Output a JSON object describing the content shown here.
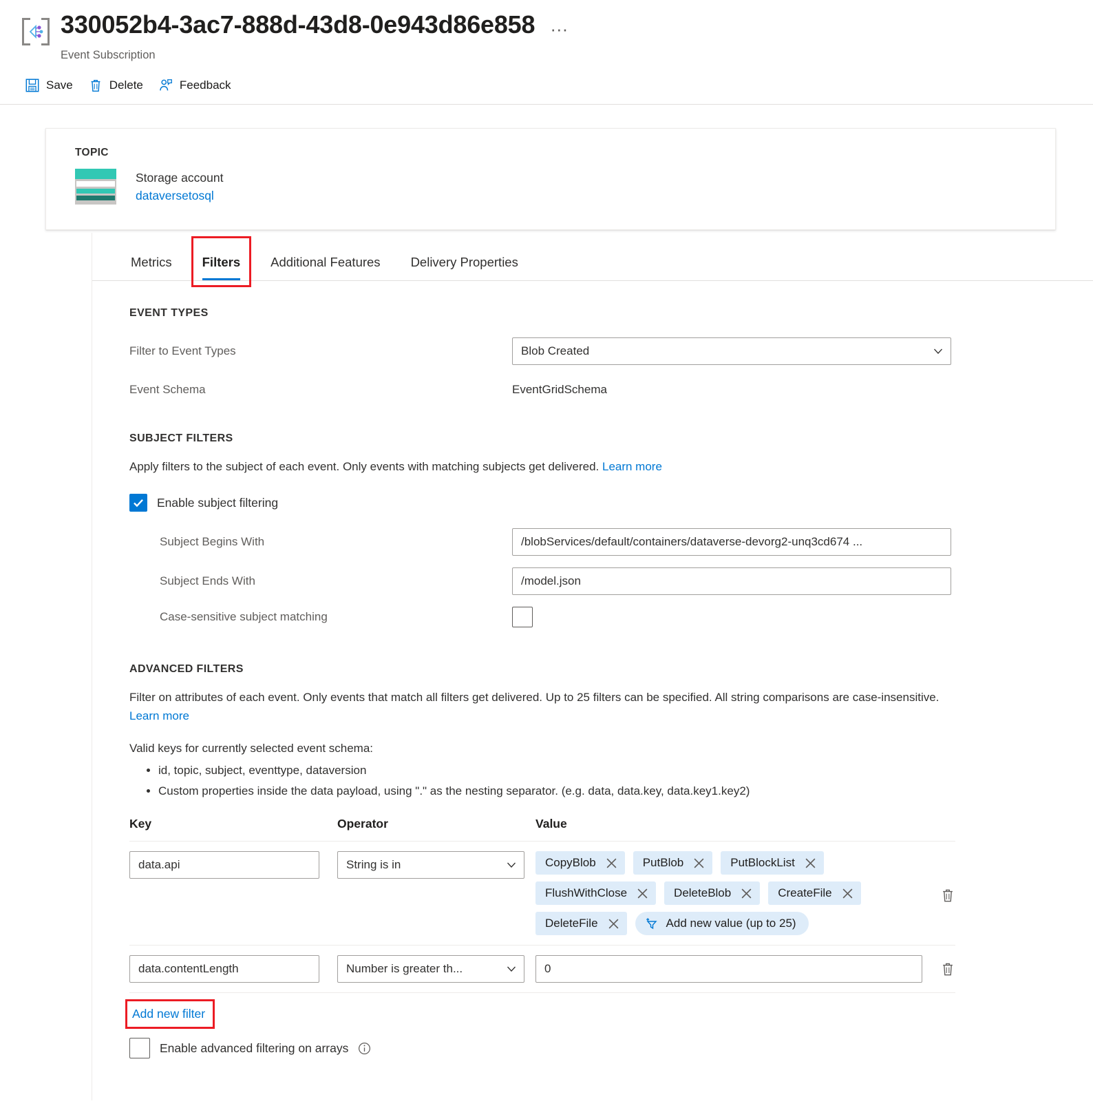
{
  "header": {
    "title": "330052b4-3ac7-888d-43d8-0e943d86e858",
    "subtitle": "Event Subscription",
    "more_label": "···",
    "icon": "event-subscription-icon"
  },
  "commandbar": {
    "items": [
      {
        "label": "Save",
        "icon": "save-icon"
      },
      {
        "label": "Delete",
        "icon": "trash-icon"
      },
      {
        "label": "Feedback",
        "icon": "feedback-person-icon"
      }
    ]
  },
  "topic": {
    "label": "TOPIC",
    "icon": "storage-account-icon",
    "kind": "Storage account",
    "name": "dataversetosql"
  },
  "tabs": [
    {
      "label": "Metrics",
      "active": false,
      "highlighted": false
    },
    {
      "label": "Filters",
      "active": true,
      "highlighted": true
    },
    {
      "label": "Additional Features",
      "active": false,
      "highlighted": false
    },
    {
      "label": "Delivery Properties",
      "active": false,
      "highlighted": false
    }
  ],
  "event_types": {
    "section_title": "EVENT TYPES",
    "filter_label": "Filter to Event Types",
    "filter_value": "Blob Created",
    "schema_label": "Event Schema",
    "schema_value": "EventGridSchema"
  },
  "subject_filters": {
    "section_title": "SUBJECT FILTERS",
    "description": "Apply filters to the subject of each event. Only events with matching subjects get delivered.",
    "learn_more": "Learn more",
    "enable_label": "Enable subject filtering",
    "enable_checked": true,
    "begins_with_label": "Subject Begins With",
    "begins_with_value": "/blobServices/default/containers/dataverse-devorg2-unq3cd674 ...",
    "ends_with_label": "Subject Ends With",
    "ends_with_value": "/model.json",
    "case_sensitive_label": "Case-sensitive subject matching",
    "case_sensitive_checked": false
  },
  "advanced_filters": {
    "section_title": "ADVANCED FILTERS",
    "description": "Filter on attributes of each event. Only events that match all filters get delivered. Up to 25 filters can be specified. All string comparisons are case-insensitive.",
    "learn_more": "Learn more",
    "valid_keys_intro": "Valid keys for currently selected event schema:",
    "valid_keys": [
      "id, topic, subject, eventtype, dataversion",
      "Custom properties inside the data payload, using \".\" as the nesting separator. (e.g. data, data.key, data.key1.key2)"
    ],
    "columns": {
      "key": "Key",
      "operator": "Operator",
      "value": "Value"
    },
    "rows": [
      {
        "key": "data.api",
        "operator": "String is in",
        "value_type": "chips",
        "chips": [
          "CopyBlob",
          "PutBlob",
          "PutBlockList",
          "FlushWithClose",
          "DeleteBlob",
          "CreateFile",
          "DeleteFile"
        ],
        "add_value_label": "Add new value (up to 25)",
        "delete_icon": "trash-icon"
      },
      {
        "key": "data.contentLength",
        "operator": "Number is greater th...",
        "value_type": "text",
        "value": "0",
        "delete_icon": "trash-icon"
      }
    ],
    "add_new_filter": "Add new filter",
    "arrays_label": "Enable advanced filtering on arrays",
    "arrays_checked": false,
    "arrays_info_icon": "info-icon"
  },
  "colors": {
    "accent": "#0078d4",
    "chip_bg": "#deecf9",
    "highlight": "#ec1c24",
    "storage_teal": "#32c8b4"
  }
}
